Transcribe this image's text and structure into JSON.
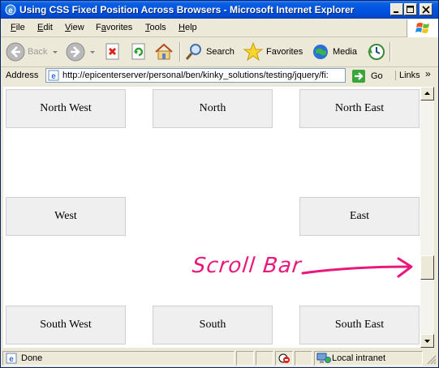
{
  "window": {
    "title": "Using CSS Fixed Position Across Browsers - Microsoft Internet Explorer"
  },
  "menu": [
    {
      "label": "File",
      "key": "F",
      "rest": "ile"
    },
    {
      "label": "Edit",
      "key": "E",
      "rest": "dit"
    },
    {
      "label": "View",
      "key": "V",
      "rest": "iew"
    },
    {
      "label": "Favorites",
      "key": "a",
      "pre": "F",
      "rest": "vorites"
    },
    {
      "label": "Tools",
      "key": "T",
      "rest": "ools"
    },
    {
      "label": "Help",
      "key": "H",
      "rest": "elp"
    }
  ],
  "toolbar": {
    "back_label": "Back",
    "search_label": "Search",
    "favorites_label": "Favorites",
    "media_label": "Media"
  },
  "address": {
    "label": "Address",
    "url": "http://epicenterserver/personal/ben/kinky_solutions/testing/jquery/fi:",
    "go_label": "Go",
    "links_label": "Links",
    "chevron": "»"
  },
  "boxes": {
    "north_west": "North West",
    "north": "North",
    "north_east": "North East",
    "west": "West",
    "east": "East",
    "south_west": "South West",
    "south": "South",
    "south_east": "South East"
  },
  "annotation": "Scroll Bar",
  "status": {
    "text": "Done",
    "zone": "Local intranet"
  },
  "colors": {
    "annotation": "#e8197b",
    "titlebar": "#0054e3"
  }
}
